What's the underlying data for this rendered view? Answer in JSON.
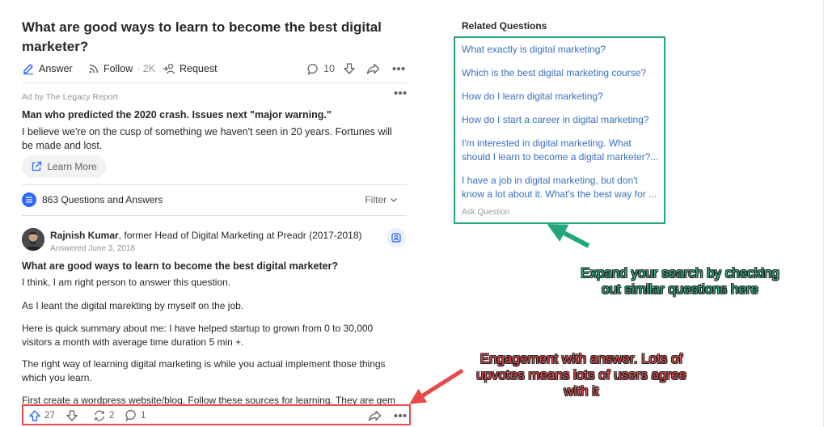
{
  "question": {
    "title": "What are good ways to learn to become the best digital marketer?",
    "actions": {
      "answer_label": "Answer",
      "follow_label": "Follow",
      "follow_count": "· 2K",
      "request_label": "Request",
      "comment_count": "10"
    }
  },
  "ad": {
    "label": "Ad by The Legacy Report",
    "title": "Man who predicted the 2020 crash. Issues next \"major warning.\"",
    "body": "I believe we're on the cusp of something we haven't seen in 20 years. Fortunes will be made and lost.",
    "cta_label": "Learn More"
  },
  "answers_section": {
    "count_label": "863 Questions and Answers",
    "filter_label": "Filter"
  },
  "answer": {
    "author_name": "Rajnish Kumar",
    "author_credential": ", former Head of Digital Marketing at Preadr (2017-2018)",
    "date": "Answered June 3, 2018",
    "question_title": "What are good ways to learn to become the best digital marketer?",
    "paragraphs": [
      "I think, I am right person to answer this question.",
      "As I leant the digital marekting by myself on the job.",
      "Here is quick summary about me: I have helped startup to grown from 0 to 30,000 visitors a month with average time duration 5 min +.",
      "The right way of learning digital marketing is while you actual implement those things which you learn.",
      "First create a wordpress website/blog. Follow these sources for learning. They are gem in"
    ],
    "upvotes": "27",
    "shares": "2",
    "comments": "1"
  },
  "related": {
    "heading": "Related Questions",
    "items": [
      "What exactly is digital marketing?",
      "Which is the best digital marketing course?",
      "How do I learn digital marketing?",
      "How do I start a career in digital marketing?",
      "I'm interested in digital marketing. What should I learn to become a digital marketer?...",
      "I have a job in digital marketing, but don't know a lot about it. What's the best way for ..."
    ],
    "ask_label": "Ask Question"
  },
  "annotations": {
    "related_callout": "Expand your search by checking out similar questions here",
    "engagement_callout": "Engagement with answer. Lots of upvotes means lots of users agree with it"
  },
  "colors": {
    "brand_blue": "#2e69ff",
    "link_blue": "#3b6fbe",
    "annotation_green": "#24a67b",
    "annotation_red": "#e84a4a"
  }
}
